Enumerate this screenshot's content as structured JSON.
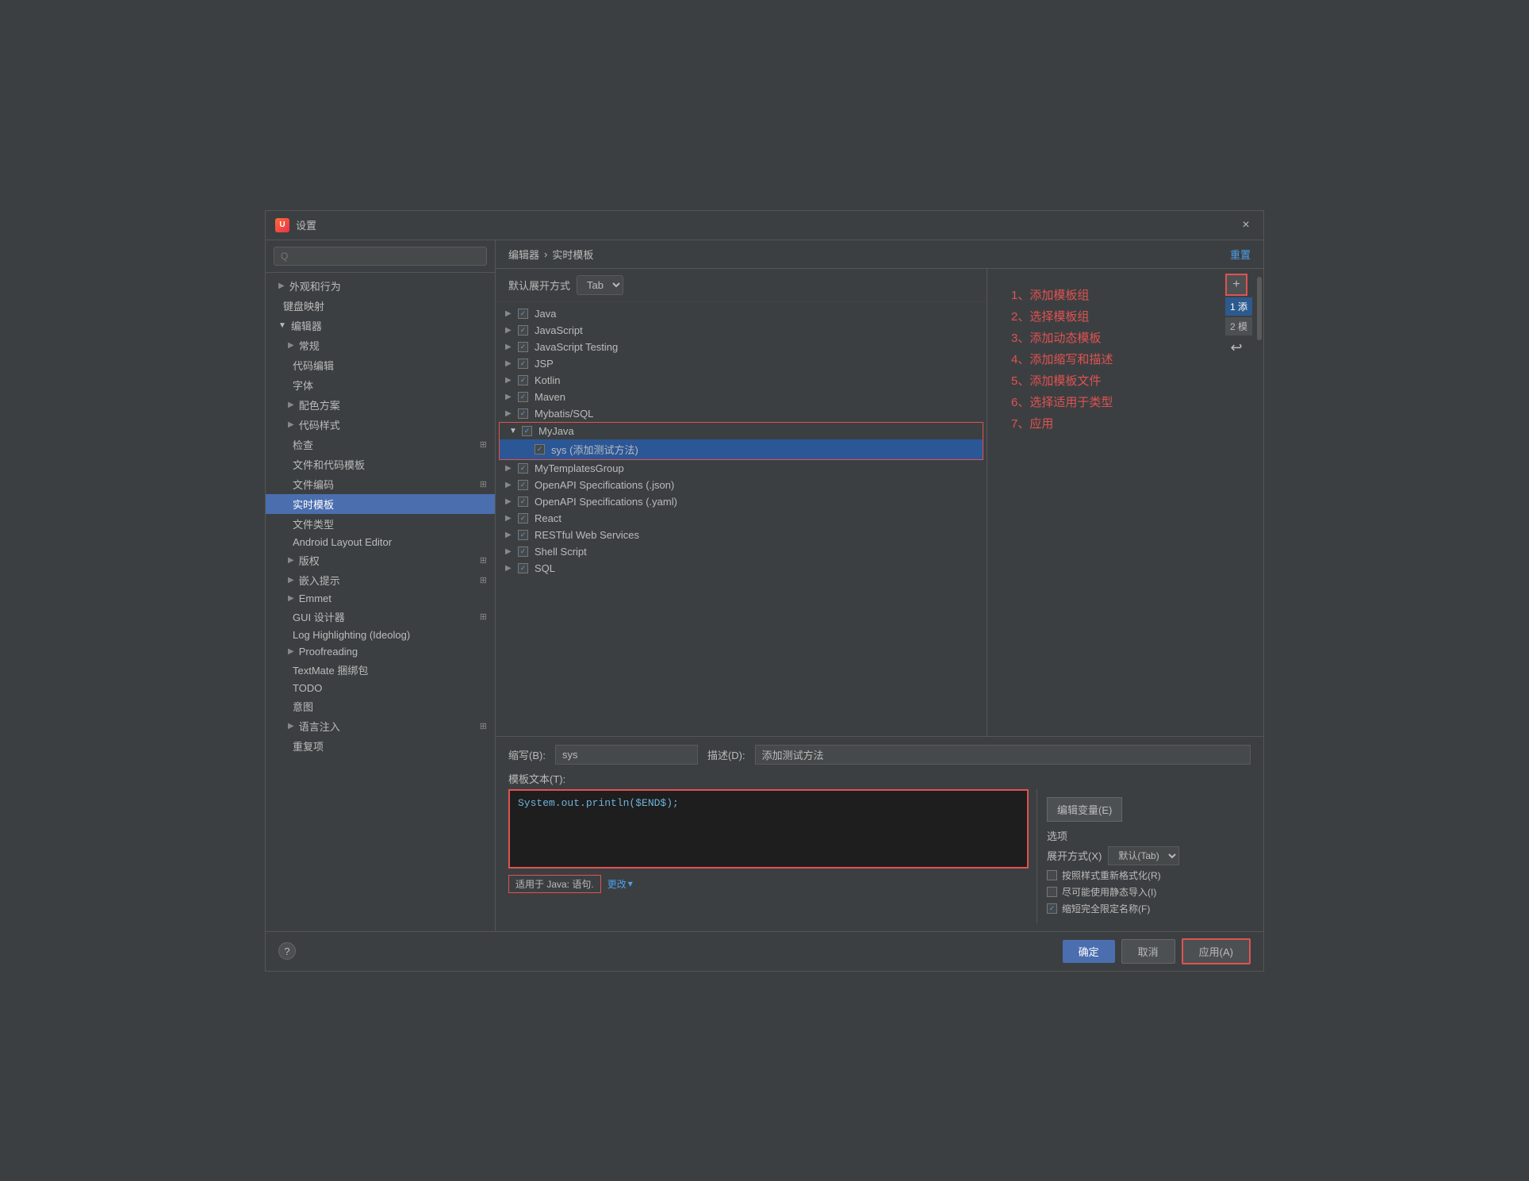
{
  "dialog": {
    "title": "设置",
    "close_label": "×"
  },
  "search": {
    "placeholder": "Q"
  },
  "sidebar": {
    "sections": [
      {
        "id": "appearance",
        "label": "外观和行为",
        "arrow": "▶",
        "indent": 0,
        "expanded": false
      },
      {
        "id": "keymap",
        "label": "键盘映射",
        "arrow": "",
        "indent": 0,
        "expanded": false,
        "no_arrow": true
      },
      {
        "id": "editor",
        "label": "编辑器",
        "arrow": "▼",
        "indent": 0,
        "expanded": true
      },
      {
        "id": "general",
        "label": "常规",
        "arrow": "▶",
        "indent": 1,
        "expanded": false
      },
      {
        "id": "code_edit",
        "label": "代码编辑",
        "arrow": "",
        "indent": 1,
        "no_arrow": true
      },
      {
        "id": "font",
        "label": "字体",
        "arrow": "",
        "indent": 1,
        "no_arrow": true
      },
      {
        "id": "color_scheme",
        "label": "配色方案",
        "arrow": "▶",
        "indent": 1
      },
      {
        "id": "code_style",
        "label": "代码样式",
        "arrow": "▶",
        "indent": 1
      },
      {
        "id": "inspection",
        "label": "检查",
        "arrow": "",
        "indent": 1,
        "no_arrow": true,
        "has_ext": true
      },
      {
        "id": "file_templates",
        "label": "文件和代码模板",
        "arrow": "",
        "indent": 1,
        "no_arrow": true
      },
      {
        "id": "file_encoding",
        "label": "文件编码",
        "arrow": "",
        "indent": 1,
        "no_arrow": true,
        "has_ext": true
      },
      {
        "id": "live_templates",
        "label": "实时模板",
        "arrow": "",
        "indent": 1,
        "no_arrow": true,
        "active": true
      },
      {
        "id": "file_types",
        "label": "文件类型",
        "arrow": "",
        "indent": 1,
        "no_arrow": true
      },
      {
        "id": "android_layout",
        "label": "Android Layout Editor",
        "arrow": "",
        "indent": 1,
        "no_arrow": true
      },
      {
        "id": "copyright",
        "label": "版权",
        "arrow": "▶",
        "indent": 1,
        "has_ext": true
      },
      {
        "id": "inlay_hints",
        "label": "嵌入提示",
        "arrow": "▶",
        "indent": 1,
        "has_ext": true
      },
      {
        "id": "emmet",
        "label": "Emmet",
        "arrow": "▶",
        "indent": 1
      },
      {
        "id": "gui_designer",
        "label": "GUI 设计器",
        "arrow": "",
        "indent": 1,
        "no_arrow": true,
        "has_ext": true
      },
      {
        "id": "log_highlighting",
        "label": "Log Highlighting (Ideolog)",
        "arrow": "",
        "indent": 1,
        "no_arrow": true
      },
      {
        "id": "proofreading",
        "label": "Proofreading",
        "arrow": "▶",
        "indent": 1
      },
      {
        "id": "textmate",
        "label": "TextMate 捆绑包",
        "arrow": "",
        "indent": 1,
        "no_arrow": true
      },
      {
        "id": "todo",
        "label": "TODO",
        "arrow": "",
        "indent": 1,
        "no_arrow": true
      },
      {
        "id": "intention",
        "label": "意图",
        "arrow": "",
        "indent": 1,
        "no_arrow": true
      },
      {
        "id": "lang_injection",
        "label": "语言注入",
        "arrow": "▶",
        "indent": 1,
        "has_ext": true
      },
      {
        "id": "reset_items",
        "label": "重复项",
        "arrow": "",
        "indent": 1,
        "no_arrow": true
      }
    ]
  },
  "breadcrumb": {
    "part1": "编辑器",
    "sep": "›",
    "part2": "实时模板"
  },
  "reset_label": "重置",
  "expand_default": {
    "label": "默认展开方式",
    "value": "Tab"
  },
  "template_groups": [
    {
      "id": "java",
      "label": "Java",
      "checked": true,
      "expanded": false
    },
    {
      "id": "javascript",
      "label": "JavaScript",
      "checked": true,
      "expanded": false
    },
    {
      "id": "javascript_testing",
      "label": "JavaScript Testing",
      "checked": true,
      "expanded": false
    },
    {
      "id": "jsp",
      "label": "JSP",
      "checked": true,
      "expanded": false
    },
    {
      "id": "kotlin",
      "label": "Kotlin",
      "checked": true,
      "expanded": false
    },
    {
      "id": "maven",
      "label": "Maven",
      "checked": true,
      "expanded": false
    },
    {
      "id": "mybatis",
      "label": "Mybatis/SQL",
      "checked": true,
      "expanded": false
    },
    {
      "id": "myjava",
      "label": "MyJava",
      "checked": true,
      "expanded": true,
      "highlighted": true
    },
    {
      "id": "sys",
      "label": "sys (添加测试方法)",
      "checked": true,
      "indent": 1,
      "selected": true
    },
    {
      "id": "mytemplates",
      "label": "MyTemplatesGroup",
      "checked": true,
      "expanded": false
    },
    {
      "id": "openapi_json",
      "label": "OpenAPI Specifications (.json)",
      "checked": true,
      "expanded": false
    },
    {
      "id": "openapi_yaml",
      "label": "OpenAPI Specifications (.yaml)",
      "checked": true,
      "expanded": false
    },
    {
      "id": "react",
      "label": "React",
      "checked": true,
      "expanded": false
    },
    {
      "id": "restful",
      "label": "RESTful Web Services",
      "checked": true,
      "expanded": false
    },
    {
      "id": "shell",
      "label": "Shell Script",
      "checked": true,
      "expanded": false
    },
    {
      "id": "sql",
      "label": "SQL",
      "checked": true,
      "expanded": false
    }
  ],
  "annotation": {
    "text": "1、添加模板组\n2、选择模板组\n3、添加动态模板\n4、添加缩写和描述\n5、添加模板文件\n6、选择适用于类型\n7、应用"
  },
  "toolbar_buttons": [
    {
      "id": "add",
      "label": "+"
    },
    {
      "id": "item1",
      "label": "1 添"
    },
    {
      "id": "item2",
      "label": "2 模"
    }
  ],
  "abbreviation": {
    "label": "缩写(B):",
    "value": "sys"
  },
  "description": {
    "label": "描述(D):",
    "value": "添加测试方法"
  },
  "template_text": {
    "label": "模板文本(T):",
    "value": "System.out.println($END$);"
  },
  "edit_var_btn": "编辑变量(E)",
  "options": {
    "title": "选项",
    "expand_label": "展开方式(X)",
    "expand_value": "默认(Tab)",
    "checkbox1": {
      "label": "按照样式重新格式化(R)",
      "checked": false
    },
    "checkbox2": {
      "label": "尽可能使用静态导入(I)",
      "checked": false
    },
    "checkbox3": {
      "label": "缩短完全限定名称(F)",
      "checked": true
    }
  },
  "applicable": {
    "label": "适用于 Java: 语句.",
    "change_label": "更改"
  },
  "footer": {
    "confirm": "确定",
    "cancel": "取消",
    "apply": "应用(A)",
    "help": "?"
  }
}
